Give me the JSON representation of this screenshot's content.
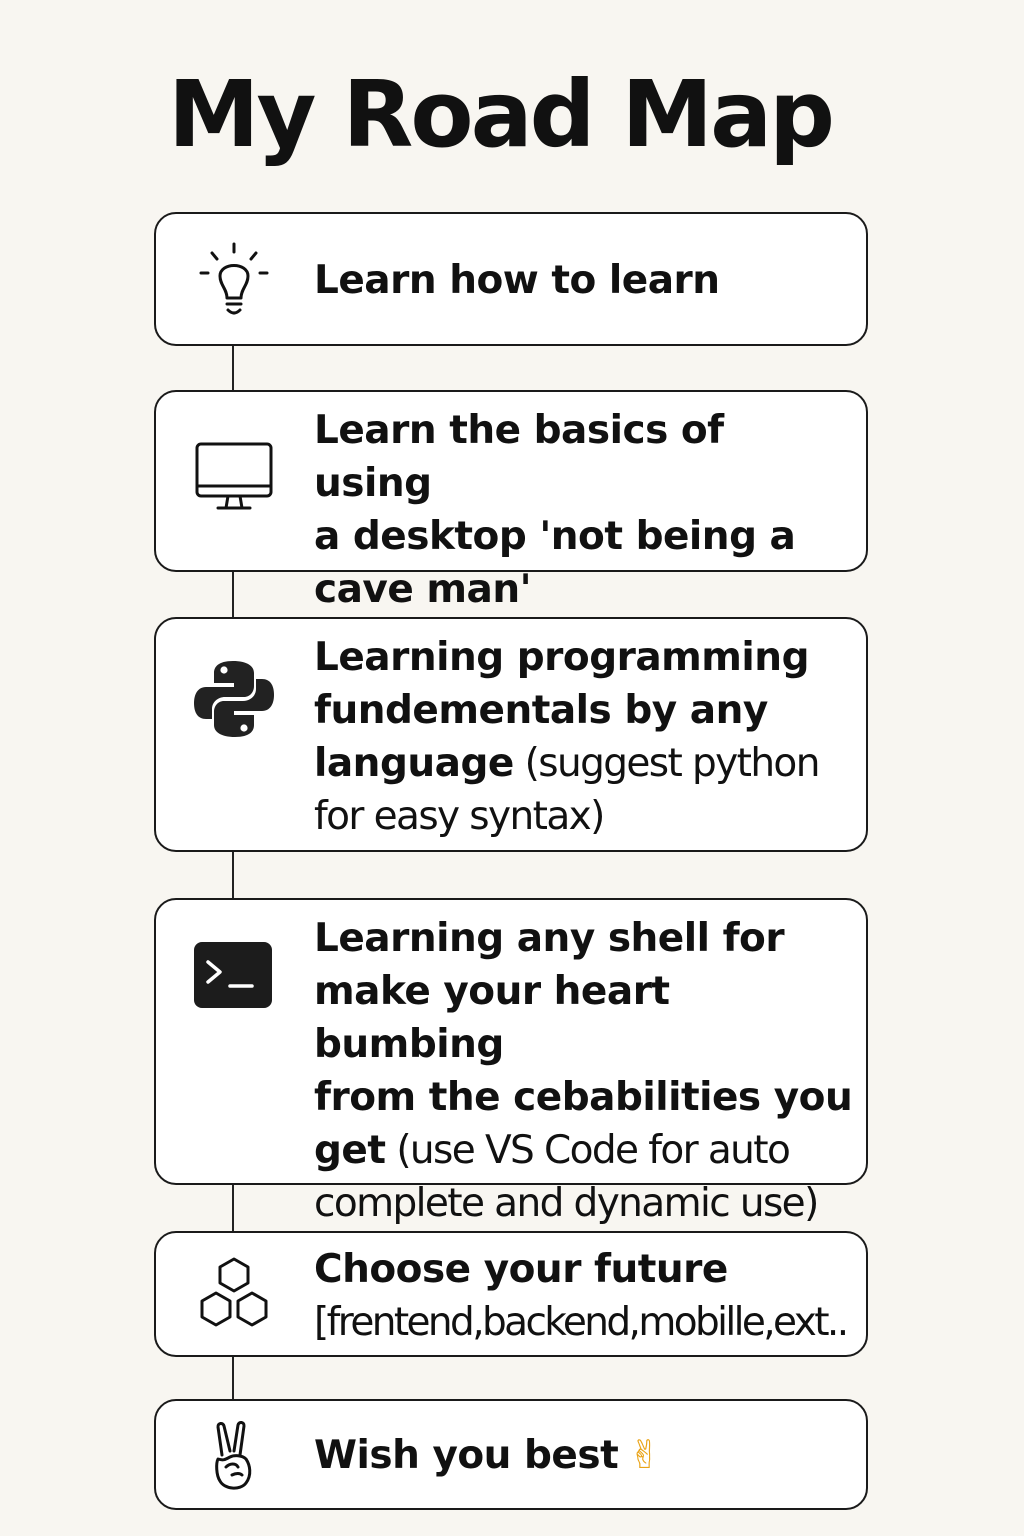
{
  "title": "My Road Map",
  "steps": [
    {
      "icon": "lightbulb-icon",
      "lines": [
        "Learn how to learn"
      ]
    },
    {
      "icon": "desktop-monitor-icon",
      "lines": [
        "Learn the basics of using",
        "a desktop 'not being a",
        "cave man'"
      ]
    },
    {
      "icon": "python-logo-icon",
      "lines": [
        "Learning programming",
        "fundementals by any",
        "language",
        " (suggest python",
        "for easy syntax)"
      ]
    },
    {
      "icon": "terminal-icon",
      "lines": [
        "Learning any shell for",
        "make your heart bumbing",
        "from the cebabilities you",
        "get",
        " (use VS Code for auto",
        "complete and dynamic use)"
      ]
    },
    {
      "icon": "hexagons-icon",
      "lines": [
        "Choose your future",
        "[frentend,backend,mobille,ext.."
      ]
    },
    {
      "icon": "victory-hand-icon",
      "lines": [
        "Wish you best"
      ],
      "emoji": "✌"
    }
  ],
  "colors": {
    "background": "#f8f6f1",
    "card": "#ffffff",
    "border": "#1a1a1a",
    "text": "#111111",
    "emoji": "#e9a317"
  }
}
